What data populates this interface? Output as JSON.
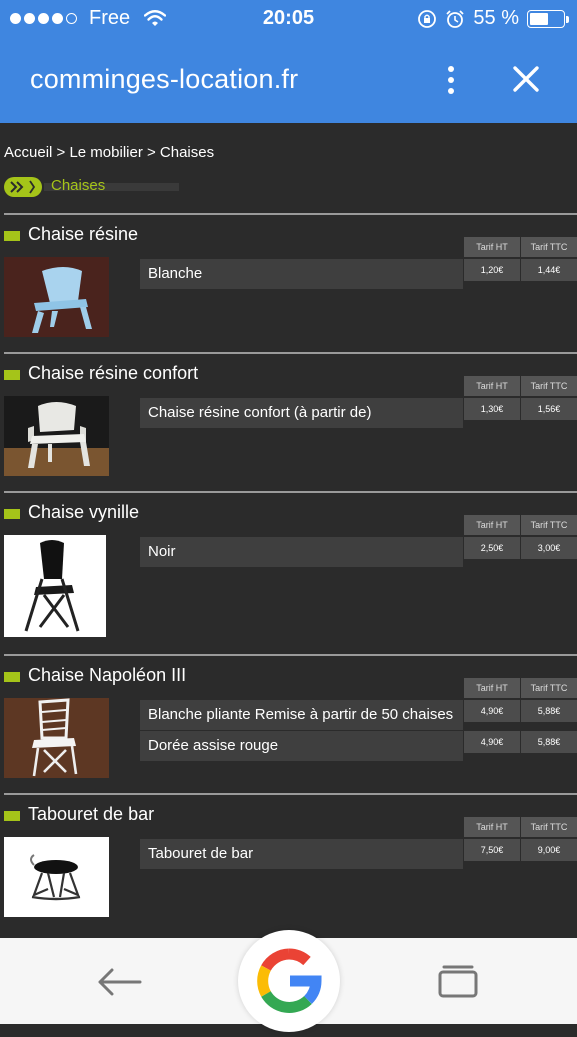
{
  "status_bar": {
    "carrier": "Free",
    "time": "20:05",
    "battery": "55 %",
    "battery_level": 0.55
  },
  "browser": {
    "url": "comminges-location.fr",
    "icons": [
      "more-vert-icon",
      "close-icon"
    ]
  },
  "breadcrumb": "Accueil > Le mobilier > Chaises",
  "category": "Chaises",
  "headers": {
    "ht": "Tarif HT",
    "ttc": "Tarif TTC"
  },
  "products": [
    {
      "name": "Chaise résine",
      "rows": [
        {
          "label": "Blanche",
          "ht": "1,20€",
          "ttc": "1,44€"
        }
      ]
    },
    {
      "name": "Chaise résine confort",
      "rows": [
        {
          "label": "Chaise résine confort (à partir de)",
          "ht": "1,30€",
          "ttc": "1,56€"
        }
      ]
    },
    {
      "name": "Chaise vynille",
      "rows": [
        {
          "label": "Noir",
          "ht": "2,50€",
          "ttc": "3,00€"
        }
      ]
    },
    {
      "name": "Chaise Napoléon III",
      "rows": [
        {
          "label": "Blanche pliante Remise à partir de 50 chaises",
          "ht": "4,90€",
          "ttc": "5,88€"
        },
        {
          "label": "Dorée assise rouge",
          "ht": "4,90€",
          "ttc": "5,88€"
        }
      ]
    },
    {
      "name": "Tabouret de bar",
      "rows": [
        {
          "label": "Tabouret de bar",
          "ht": "7,50€",
          "ttc": "9,00€"
        }
      ]
    }
  ],
  "colors": {
    "header": "#3f86e0",
    "accent": "#a5c419",
    "background": "#2b2b2b"
  },
  "navbar_icons": [
    "back-arrow-icon",
    "google-icon",
    "tabs-icon"
  ]
}
